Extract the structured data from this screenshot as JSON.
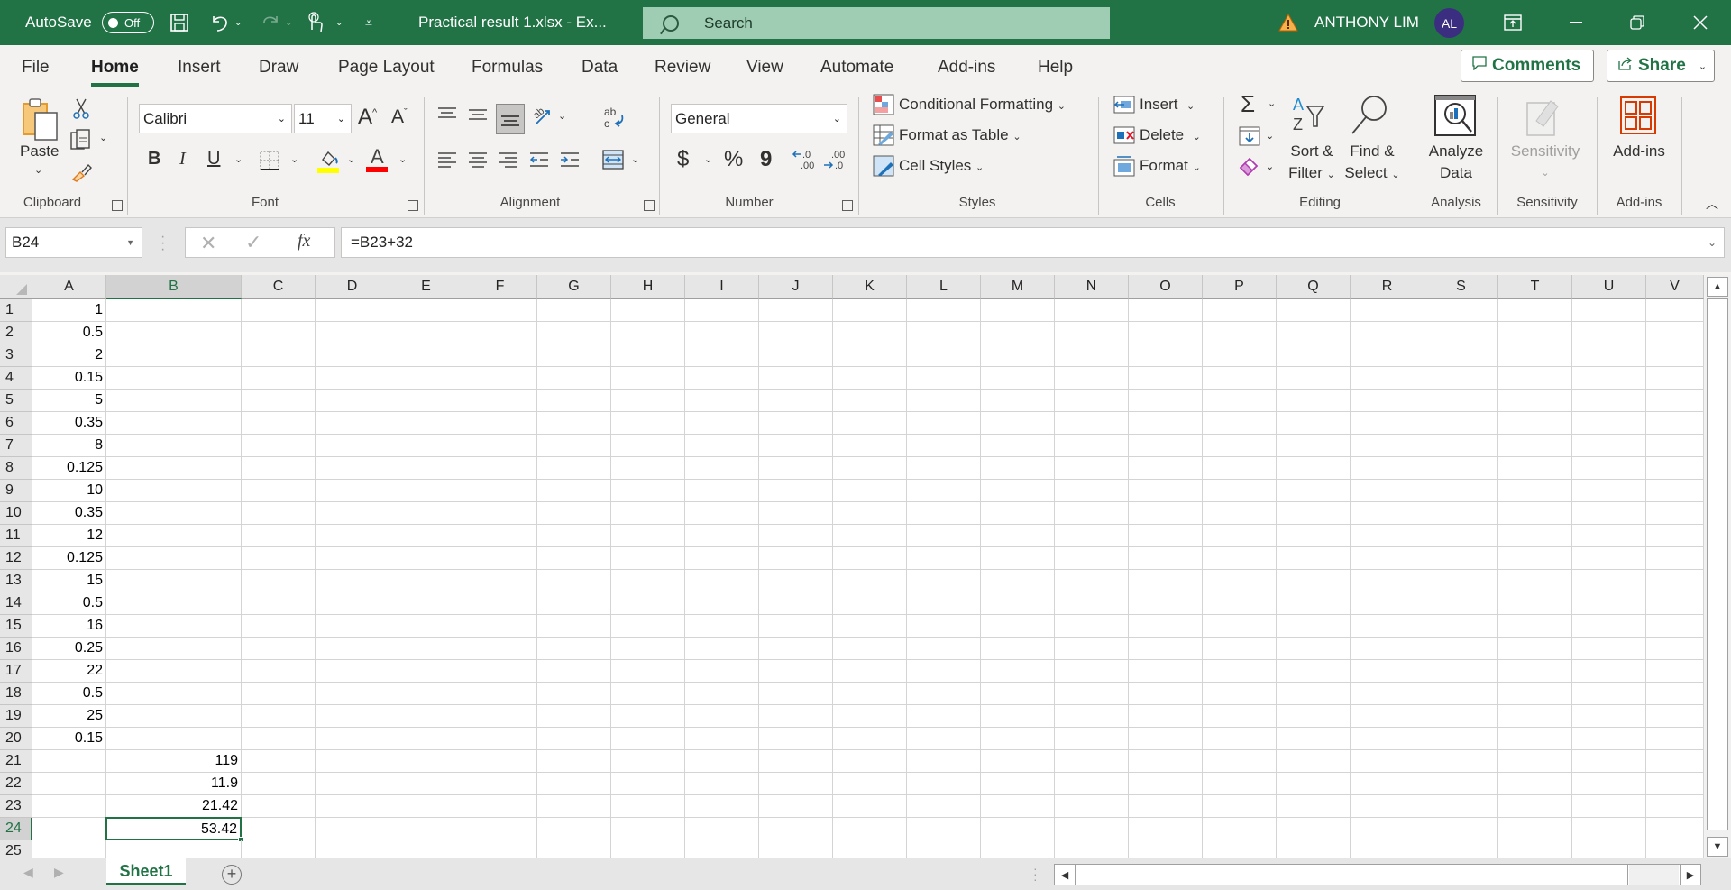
{
  "titlebar": {
    "autosave_label": "AutoSave",
    "autosave_state": "Off",
    "document_title": "Practical result 1.xlsx  -  Ex...",
    "search_placeholder": "Search",
    "user_name": "ANTHONY LIM",
    "user_initials": "AL",
    "brand_color": "#217346"
  },
  "menu": {
    "tabs": [
      "File",
      "Home",
      "Insert",
      "Draw",
      "Page Layout",
      "Formulas",
      "Data",
      "Review",
      "View",
      "Automate",
      "Add-ins",
      "Help"
    ],
    "active_tab": "Home",
    "comments_label": "Comments",
    "share_label": "Share"
  },
  "ribbon": {
    "clipboard": {
      "paste_label": "Paste",
      "group_label": "Clipboard"
    },
    "font": {
      "font_name": "Calibri",
      "font_size": "11",
      "bold": "B",
      "italic": "I",
      "underline": "U",
      "group_label": "Font",
      "highlight_color": "#ffff00",
      "font_color": "#ff0000"
    },
    "alignment": {
      "group_label": "Alignment"
    },
    "number": {
      "format": "General",
      "currency": "$",
      "percent": "%",
      "comma": "9",
      "group_label": "Number"
    },
    "styles": {
      "conditional_formatting": "Conditional Formatting",
      "format_as_table": "Format as Table",
      "cell_styles": "Cell Styles",
      "group_label": "Styles"
    },
    "cells": {
      "insert": "Insert",
      "delete": "Delete",
      "format": "Format",
      "group_label": "Cells"
    },
    "editing": {
      "autosum": "Σ",
      "sort_filter_line1": "Sort &",
      "sort_filter_line2": "Filter",
      "find_select_line1": "Find &",
      "find_select_line2": "Select",
      "group_label": "Editing"
    },
    "analysis": {
      "analyze_line1": "Analyze",
      "analyze_line2": "Data",
      "group_label": "Analysis"
    },
    "sensitivity": {
      "label": "Sensitivity",
      "group_label": "Sensitivity"
    },
    "addins": {
      "label": "Add-ins",
      "group_label": "Add-ins"
    }
  },
  "formula_bar": {
    "name_box": "B24",
    "formula": "=B23+32",
    "fx": "fx"
  },
  "sheet": {
    "columns": [
      "A",
      "B",
      "C",
      "D",
      "E",
      "F",
      "G",
      "H",
      "I",
      "J",
      "K",
      "L",
      "M",
      "N",
      "O",
      "P",
      "Q",
      "R",
      "S",
      "T",
      "U",
      "V"
    ],
    "selected_column": "B",
    "selected_row": 24,
    "active_cell": "B24",
    "rows": [
      {
        "n": 1,
        "A": "1",
        "B": ""
      },
      {
        "n": 2,
        "A": "0.5",
        "B": ""
      },
      {
        "n": 3,
        "A": "2",
        "B": ""
      },
      {
        "n": 4,
        "A": "0.15",
        "B": ""
      },
      {
        "n": 5,
        "A": "5",
        "B": ""
      },
      {
        "n": 6,
        "A": "0.35",
        "B": ""
      },
      {
        "n": 7,
        "A": "8",
        "B": ""
      },
      {
        "n": 8,
        "A": "0.125",
        "B": ""
      },
      {
        "n": 9,
        "A": "10",
        "B": ""
      },
      {
        "n": 10,
        "A": "0.35",
        "B": ""
      },
      {
        "n": 11,
        "A": "12",
        "B": ""
      },
      {
        "n": 12,
        "A": "0.125",
        "B": ""
      },
      {
        "n": 13,
        "A": "15",
        "B": ""
      },
      {
        "n": 14,
        "A": "0.5",
        "B": ""
      },
      {
        "n": 15,
        "A": "16",
        "B": ""
      },
      {
        "n": 16,
        "A": "0.25",
        "B": ""
      },
      {
        "n": 17,
        "A": "22",
        "B": ""
      },
      {
        "n": 18,
        "A": "0.5",
        "B": ""
      },
      {
        "n": 19,
        "A": "25",
        "B": ""
      },
      {
        "n": 20,
        "A": "0.15",
        "B": ""
      },
      {
        "n": 21,
        "A": "",
        "B": "119"
      },
      {
        "n": 22,
        "A": "",
        "B": "11.9"
      },
      {
        "n": 23,
        "A": "",
        "B": "21.42"
      },
      {
        "n": 24,
        "A": "",
        "B": "53.42"
      },
      {
        "n": 25,
        "A": "",
        "B": ""
      }
    ]
  },
  "sheet_tabs": {
    "tabs": [
      "Sheet1"
    ],
    "active": "Sheet1"
  }
}
